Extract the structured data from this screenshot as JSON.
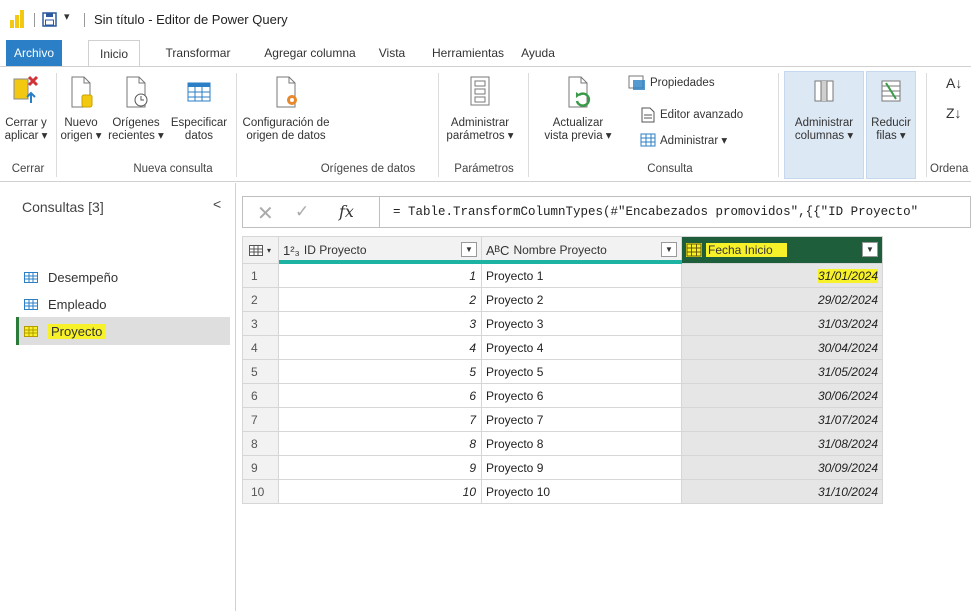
{
  "window": {
    "title": "Sin título - Editor de Power Query"
  },
  "tabs": [
    "Archivo",
    "Inicio",
    "Transformar",
    "Agregar columna",
    "Vista",
    "Herramientas",
    "Ayuda"
  ],
  "ribbon": {
    "close_apply": {
      "line1": "Cerrar y",
      "line2": "aplicar ▾"
    },
    "new_source": {
      "line1": "Nuevo",
      "line2": "origen ▾"
    },
    "recent_sources": {
      "line1": "Orígenes",
      "line2": "recientes ▾"
    },
    "enter_data": {
      "line1": "Especificar",
      "line2": "datos"
    },
    "data_source_settings": {
      "line1": "Configuración de",
      "line2": "origen de datos"
    },
    "manage_parameters": {
      "line1": "Administrar",
      "line2": "parámetros ▾"
    },
    "refresh_preview": {
      "line1": "Actualizar",
      "line2": "vista previa ▾"
    },
    "properties": "Propiedades",
    "advanced_editor": "Editor avanzado",
    "manage": "Administrar ▾",
    "manage_columns": {
      "line1": "Administrar",
      "line2": "columnas ▾"
    },
    "reduce_rows": {
      "line1": "Reducir",
      "line2": "filas ▾"
    },
    "groups": {
      "close": "Cerrar",
      "new_query": "Nueva consulta",
      "data_sources": "Orígenes de datos",
      "parameters": "Parámetros",
      "query": "Consulta",
      "sort": "Ordena"
    }
  },
  "queries": {
    "title": "Consultas [3]",
    "items": [
      {
        "label": "Desempeño"
      },
      {
        "label": "Empleado"
      },
      {
        "label": "Proyecto"
      }
    ]
  },
  "formula": "= Table.TransformColumnTypes(#\"Encabezados promovidos\",{{\"ID Proyecto\"",
  "grid": {
    "columns": [
      {
        "type": "1²₃",
        "name": "ID Proyecto"
      },
      {
        "type": "AᴮC",
        "name": "Nombre Proyecto"
      },
      {
        "type": "date",
        "name": "Fecha Inicio"
      }
    ],
    "rows": [
      {
        "n": "1",
        "id": "1",
        "name": "Proyecto 1",
        "date": "31/01/2024"
      },
      {
        "n": "2",
        "id": "2",
        "name": "Proyecto 2",
        "date": "29/02/2024"
      },
      {
        "n": "3",
        "id": "3",
        "name": "Proyecto 3",
        "date": "31/03/2024"
      },
      {
        "n": "4",
        "id": "4",
        "name": "Proyecto 4",
        "date": "30/04/2024"
      },
      {
        "n": "5",
        "id": "5",
        "name": "Proyecto 5",
        "date": "31/05/2024"
      },
      {
        "n": "6",
        "id": "6",
        "name": "Proyecto 6",
        "date": "30/06/2024"
      },
      {
        "n": "7",
        "id": "7",
        "name": "Proyecto 7",
        "date": "31/07/2024"
      },
      {
        "n": "8",
        "id": "8",
        "name": "Proyecto 8",
        "date": "31/08/2024"
      },
      {
        "n": "9",
        "id": "9",
        "name": "Proyecto 9",
        "date": "30/09/2024"
      },
      {
        "n": "10",
        "id": "10",
        "name": "Proyecto 10",
        "date": "31/10/2024"
      }
    ]
  },
  "colors": {
    "accent": "#2b7fc6",
    "highlight": "#f7f12a",
    "selected_header": "#1e5e3b",
    "quality_bar": "#1db3a3"
  }
}
